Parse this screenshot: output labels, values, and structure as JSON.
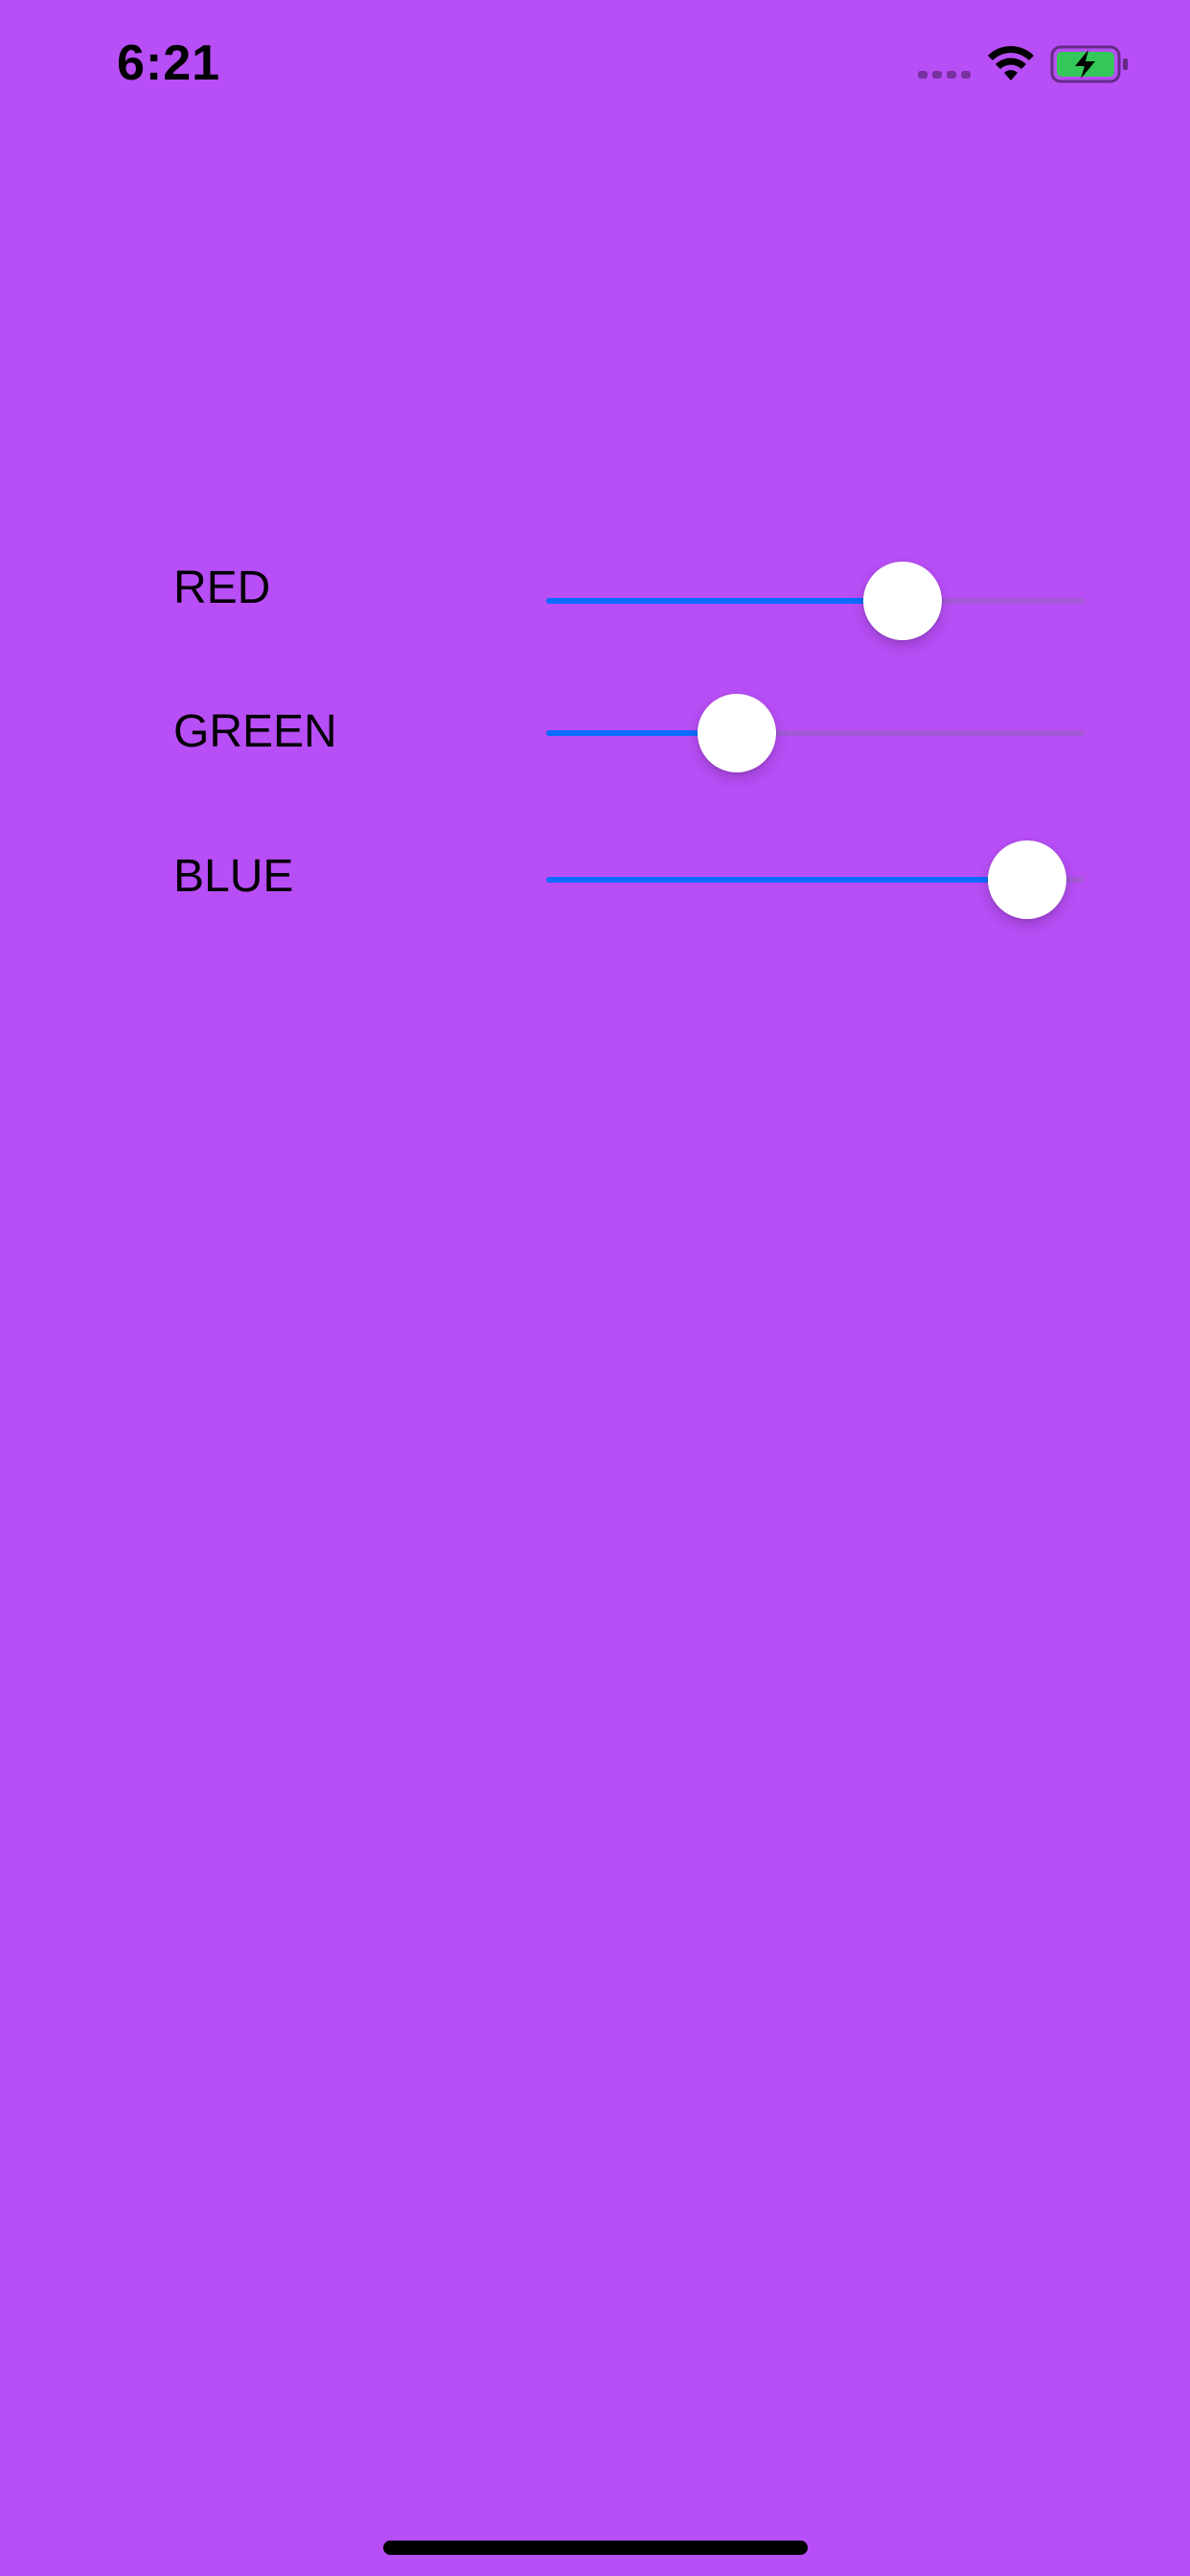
{
  "status_bar": {
    "time": "6:21",
    "icons": [
      "signal-dots-icon",
      "wifi-icon",
      "battery-charging-icon"
    ]
  },
  "colors": {
    "background": "#b84ef6",
    "slider_fill": "#0a6cff",
    "battery_fill": "#34c759"
  },
  "sliders": [
    {
      "label": "RED",
      "value": 0.69
    },
    {
      "label": "GREEN",
      "value": 0.33
    },
    {
      "label": "BLUE",
      "value": 0.96
    }
  ]
}
